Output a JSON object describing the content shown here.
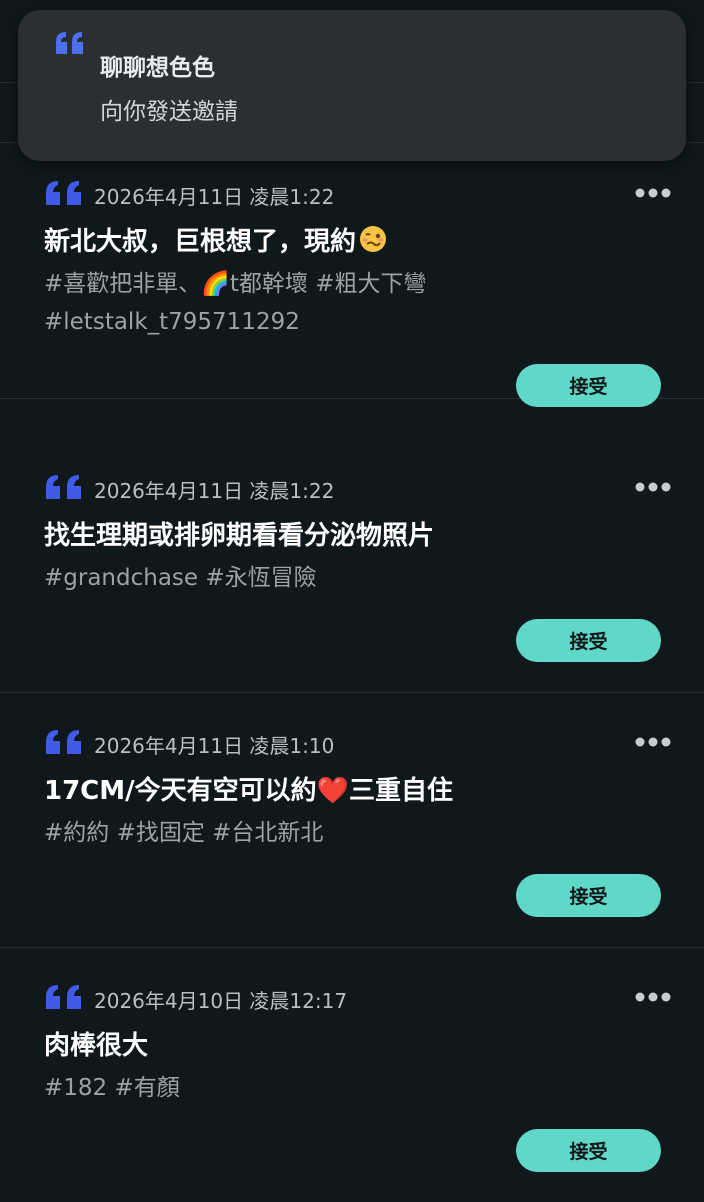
{
  "toast": {
    "title": "聊聊想色色",
    "subtitle": "向你發送邀請"
  },
  "ghost_card": {
    "accept_label": "接受"
  },
  "invitations": [
    {
      "timestamp": "2026年4月11日 凌晨1:22",
      "title": "新北大叔，巨根想了，現約",
      "title_emoji": "woozy-face-icon",
      "tags": "#喜歡把非單、🌈t都幹壞 #粗大下彎 #letstalk_t795711292",
      "accept_label": "接受"
    },
    {
      "timestamp": "2026年4月11日 凌晨1:22",
      "title": "找生理期或排卵期看看分泌物照片",
      "tags": "#grandchase #永恆冒險",
      "accept_label": "接受"
    },
    {
      "timestamp": "2026年4月11日 凌晨1:10",
      "title": "17CM/今天有空可以約❤️三重自住",
      "tags": "#約約 #找固定 #台北新北",
      "accept_label": "接受"
    },
    {
      "timestamp": "2026年4月10日 凌晨12:17",
      "title": "肉棒很大",
      "tags": "#182 #有顏",
      "accept_label": "接受"
    }
  ],
  "colors": {
    "background": "#10181b",
    "accent": "#5fd8c8",
    "quote_icon": "#4a5ef0",
    "toast": "#2b2f31"
  }
}
